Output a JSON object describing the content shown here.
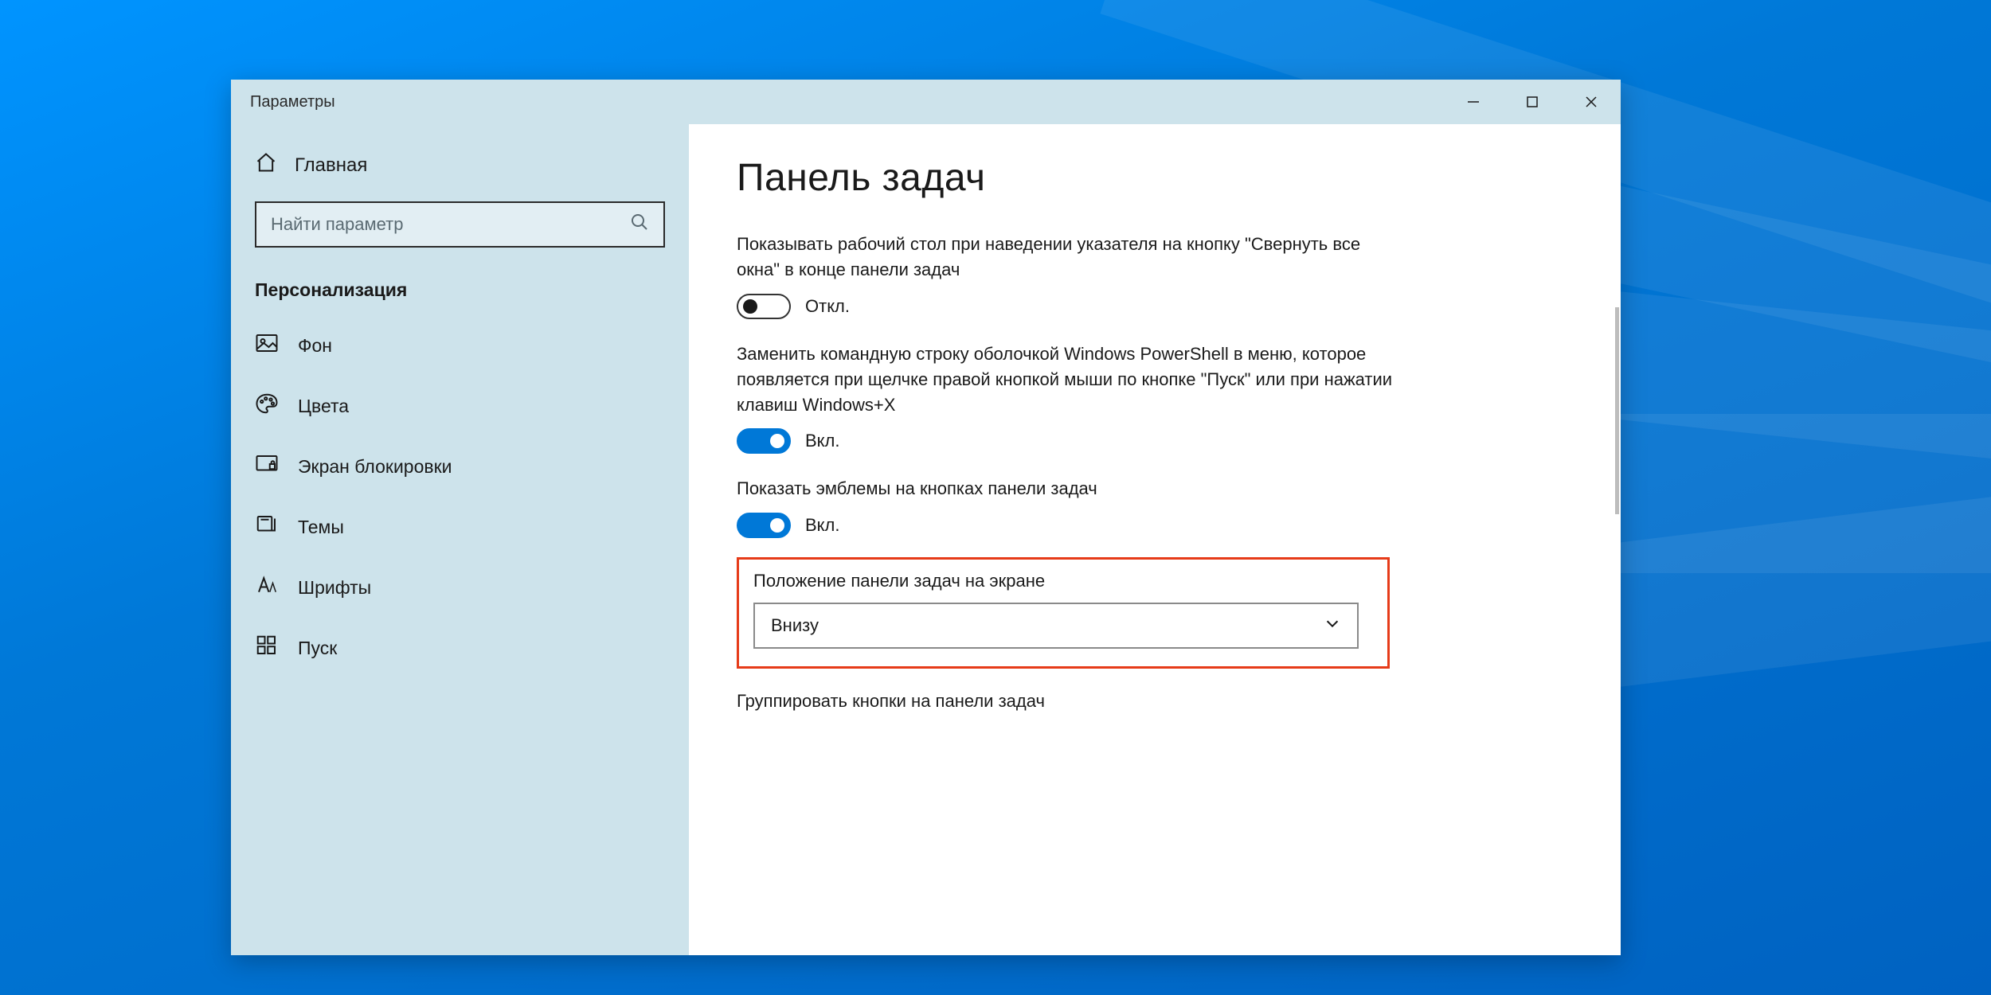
{
  "window": {
    "title": "Параметры"
  },
  "sidebar": {
    "home": "Главная",
    "search_placeholder": "Найти параметр",
    "section": "Персонализация",
    "items": [
      {
        "label": "Фон"
      },
      {
        "label": "Цвета"
      },
      {
        "label": "Экран блокировки"
      },
      {
        "label": "Темы"
      },
      {
        "label": "Шрифты"
      },
      {
        "label": "Пуск"
      }
    ]
  },
  "content": {
    "page_title": "Панель задач",
    "setting_peek": {
      "text": "Показывать рабочий стол при наведении указателя на кнопку \"Свернуть все окна\" в конце панели задач",
      "state": "off",
      "state_label": "Откл."
    },
    "setting_ps": {
      "text": "Заменить командную строку оболочкой Windows PowerShell в меню, которое появляется при щелчке правой кнопкой мыши по кнопке \"Пуск\" или при нажатии клавиш Windows+X",
      "state": "on",
      "state_label": "Вкл."
    },
    "setting_badges": {
      "text": "Показать эмблемы на кнопках панели задач",
      "state": "on",
      "state_label": "Вкл."
    },
    "position": {
      "label": "Положение панели задач на экране",
      "value": "Внизу"
    },
    "grouping": {
      "label": "Группировать кнопки на панели задач"
    }
  }
}
